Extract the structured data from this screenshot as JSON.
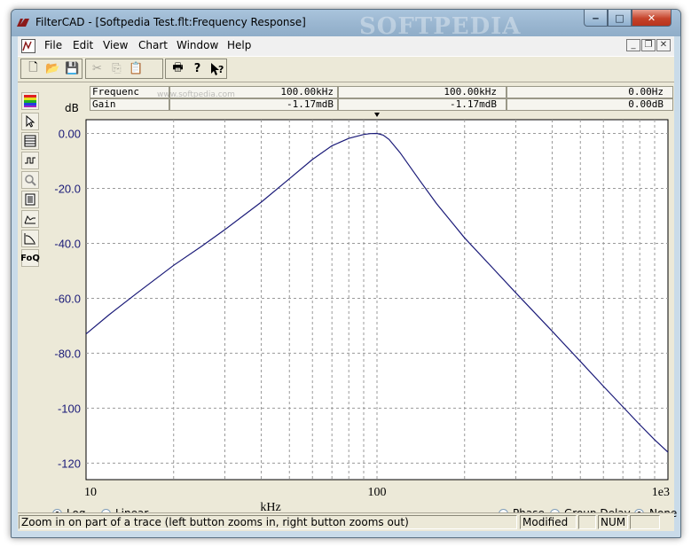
{
  "window": {
    "title": "FilterCAD - [Softpedia Test.flt:Frequency Response]",
    "watermark": "SOFTPEDIA",
    "minimize_glyph": "‒",
    "maximize_glyph": "□",
    "close_glyph": "✕"
  },
  "menu": {
    "items": [
      "File",
      "Edit",
      "View",
      "Chart",
      "Window",
      "Help"
    ],
    "mdi_minimize": "_",
    "mdi_restore": "❐",
    "mdi_close": "✕"
  },
  "toolbar": {
    "new": "🗋",
    "open": "📂",
    "save": "💾",
    "cut": "✂",
    "copy": "⎘",
    "paste": "📋",
    "print": "🖶",
    "help": "?",
    "context_help": "?"
  },
  "side_tools": {
    "foq": "FoQ"
  },
  "readout": {
    "unit": "dB",
    "row1": {
      "label": "Frequenc",
      "value1": "100.00kHz",
      "value2": "100.00kHz",
      "delta": "0.00Hz"
    },
    "row2": {
      "label": "Gain",
      "value1": "-1.17mdB",
      "value2": "-1.17mdB",
      "delta": "0.00dB"
    },
    "watermark": "www.softpedia.com"
  },
  "chart_data": {
    "type": "line",
    "x_scale": "log",
    "x_unit_label": "kHz",
    "xlim": [
      10,
      1000
    ],
    "ylim": [
      -126,
      5
    ],
    "x_tick_labels": [
      "10",
      "100",
      "1e3"
    ],
    "y_ticks": [
      0,
      -20,
      -40,
      -60,
      -80,
      -100,
      -120
    ],
    "y_tick_labels": [
      "0.00",
      "-20.0",
      "-40.0",
      "-60.0",
      "-80.0",
      "-100",
      "-120"
    ],
    "grid": true,
    "cursor_x": 100,
    "series": [
      {
        "color": "#1a1a78",
        "x": [
          10,
          12,
          15,
          20,
          25,
          30,
          40,
          50,
          60,
          70,
          80,
          90,
          95,
          100,
          105,
          110,
          120,
          140,
          160,
          200,
          250,
          300,
          400,
          500,
          600,
          700,
          800,
          900,
          1000
        ],
        "y": [
          -73,
          -66,
          -58,
          -48,
          -41,
          -35,
          -25,
          -16.5,
          -9.5,
          -4.5,
          -1.8,
          -0.4,
          -0.05,
          0,
          -0.6,
          -2.2,
          -7,
          -17,
          -25.5,
          -38,
          -49,
          -58,
          -72,
          -83,
          -92,
          -99.5,
          -106,
          -111.5,
          -116
        ]
      }
    ]
  },
  "scale_options": {
    "log_label": "Log",
    "linear_label": "Linear",
    "selected": "Log"
  },
  "trace_options": {
    "phase_label": "Phase",
    "group_delay_label": "Group Delay",
    "none_label": "None",
    "selected": "None"
  },
  "status": {
    "message": "Zoom in on part of a trace (left button zooms in, right button zooms out)",
    "modified": "Modified",
    "num": "NUM"
  },
  "colors": {
    "titlebar": "#9cb8d2",
    "trace": "#1a1a78",
    "axis_labels": "#1a1a78",
    "close_button": "#c5432a"
  }
}
